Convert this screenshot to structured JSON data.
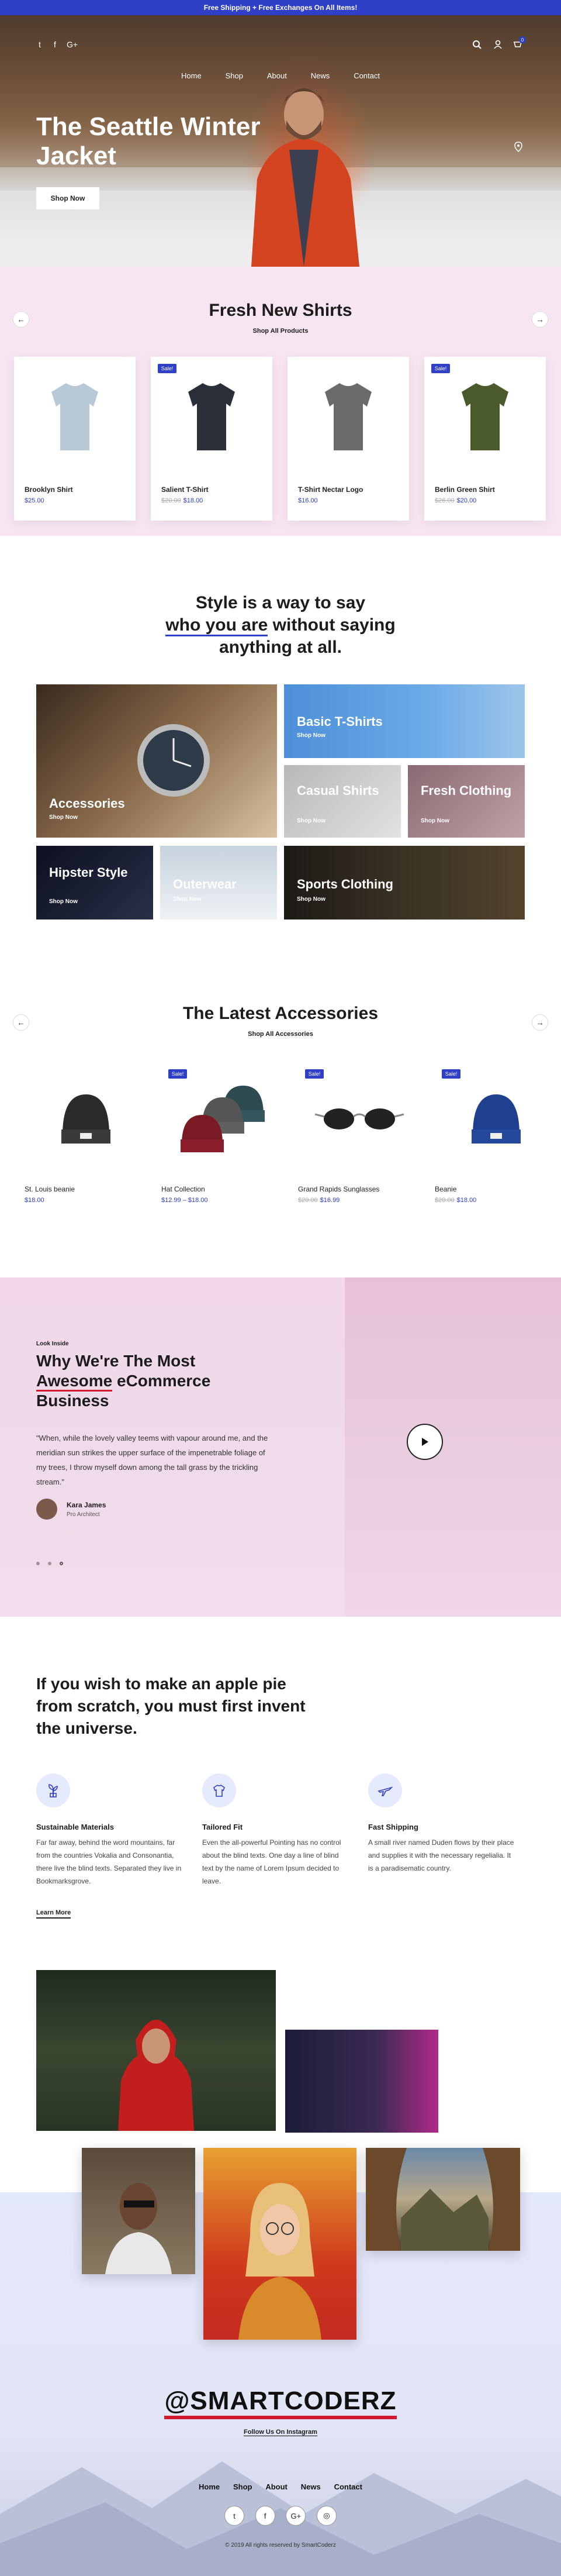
{
  "topbar": {
    "text": "Free Shipping + Free Exchanges On All Items!"
  },
  "nav": {
    "social": [
      "t",
      "f",
      "G+"
    ],
    "links": [
      "Home",
      "Shop",
      "About",
      "News",
      "Contact"
    ],
    "cart_count": "0"
  },
  "hero": {
    "title": "The Seattle Winter Jacket",
    "button": "Shop Now"
  },
  "shirts": {
    "title": "Fresh New Shirts",
    "subtitle": "Shop All Products",
    "sale_label": "Sale!",
    "items": [
      {
        "name": "Brooklyn Shirt",
        "old_price": "",
        "price": "$25.00",
        "sale": false,
        "color": "#b9c8d6"
      },
      {
        "name": "Salient T-Shirt",
        "old_price": "$20.00",
        "price": "$18.00",
        "sale": true,
        "color": "#2b2f3a"
      },
      {
        "name": "T-Shirt Nectar Logo",
        "old_price": "",
        "price": "$16.00",
        "sale": false,
        "color": "#6a6a6a"
      },
      {
        "name": "Berlin Green Shirt",
        "old_price": "$26.00",
        "price": "$20.00",
        "sale": true,
        "color": "#4a5a2a"
      }
    ]
  },
  "style": {
    "line1": "Style is a way to say",
    "highlight": "who you are",
    "line2_rest": " without saying",
    "line3": "anything at all.",
    "tiles": [
      {
        "title": "Accessories",
        "link": "Shop Now"
      },
      {
        "title": "Basic T-Shirts",
        "link": "Shop Now"
      },
      {
        "title": "Casual Shirts",
        "link": "Shop Now"
      },
      {
        "title": "Fresh Clothing",
        "link": "Shop Now"
      },
      {
        "title": "Hipster Style",
        "link": "Shop Now"
      },
      {
        "title": "Outerwear",
        "link": "Shop Now"
      },
      {
        "title": "Sports Clothing",
        "link": "Shop Now"
      }
    ]
  },
  "accessories": {
    "title": "The Latest Accessories",
    "subtitle": "Shop All Accessories",
    "sale_label": "Sale!",
    "items": [
      {
        "name": "St. Louis beanie",
        "old_price": "",
        "price": "$18.00",
        "sale": false
      },
      {
        "name": "Hat Collection",
        "old_price": "",
        "price": "$12.99 – $18.00",
        "sale": true
      },
      {
        "name": "Grand Rapids Sunglasses",
        "old_price": "$20.00",
        "price": "$16.99",
        "sale": true
      },
      {
        "name": "Beanie",
        "old_price": "$20.00",
        "price": "$18.00",
        "sale": true
      }
    ]
  },
  "why": {
    "eyebrow": "Look Inside",
    "title_line1": "Why We're The Most",
    "title_highlight": "Awesome",
    "title_line2_rest": " eCommerce",
    "title_line3": "Business",
    "quote": "\"When, while the lovely valley teems with vapour around me, and the meridian sun strikes the upper surface of the impenetrable foliage of my trees, I throw myself down among the tall grass by the trickling stream.\"",
    "author": "Kara James",
    "role": "Pro Architect"
  },
  "pie": {
    "title": "If you wish to make an apple pie from scratch, you must first invent the universe.",
    "features": [
      {
        "icon": "plant-icon",
        "title": "Sustainable Materials",
        "text": "Far far away, behind the word mountains, far from the countries Vokalia and Consonantia, there live the blind texts. Separated they live in Bookmarksgrove."
      },
      {
        "icon": "shirt-icon",
        "title": "Tailored Fit",
        "text": "Even the all-powerful Pointing has no control about the blind texts. One day a line of blind text by the name of Lorem Ipsum decided to leave."
      },
      {
        "icon": "plane-icon",
        "title": "Fast Shipping",
        "text": "A small river named Duden flows by their place and supplies it with the necessary regelialia. It is a paradisematic country."
      }
    ],
    "learn_more": "Learn More"
  },
  "instagram": {
    "handle": "@SMARTCODERZ",
    "follow": "Follow Us On Instagram"
  },
  "footer": {
    "links": [
      "Home",
      "Shop",
      "About",
      "News",
      "Contact"
    ],
    "social": [
      "t",
      "f",
      "G+",
      "◎"
    ],
    "copyright": "© 2019 All rights reserved by SmartCoderz"
  }
}
